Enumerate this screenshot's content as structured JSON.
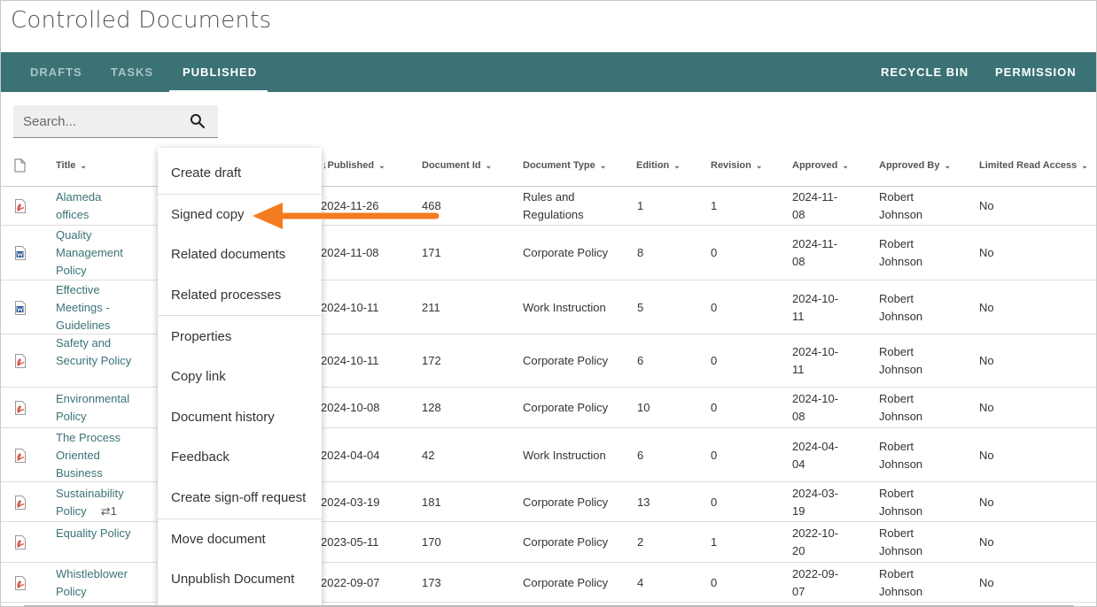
{
  "page_title": "Controlled Documents",
  "tabs": [
    {
      "label": "DRAFTS"
    },
    {
      "label": "TASKS"
    },
    {
      "label": "PUBLISHED"
    }
  ],
  "right_tabs": [
    {
      "label": "RECYCLE BIN"
    },
    {
      "label": "PERMISSION"
    }
  ],
  "active_tab": "PUBLISHED",
  "search": {
    "placeholder": "Search..."
  },
  "columns": [
    "Title",
    "Published",
    "Document Id",
    "Document Type",
    "Edition",
    "Revision",
    "Approved",
    "Approved By",
    "Limited Read Access"
  ],
  "sort": {
    "column": "Published",
    "direction": "descending"
  },
  "rows": [
    {
      "file": "pdf",
      "title": "Alameda offices",
      "published": "2024-11-26",
      "id": "468",
      "type": "Rules and Regulations",
      "edition": "1",
      "revision": "1",
      "approved": "2024-11-08",
      "approved_by": "Robert Johnson",
      "limited": "No"
    },
    {
      "file": "word",
      "title": "Quality Management Policy",
      "published": "2024-11-08",
      "id": "171",
      "type": "Corporate Policy",
      "edition": "8",
      "revision": "0",
      "approved": "2024-11-08",
      "approved_by": "Robert Johnson",
      "limited": "No"
    },
    {
      "file": "word",
      "title": "Effective Meetings - Guidelines",
      "published": "2024-10-11",
      "id": "211",
      "type": "Work Instruction",
      "edition": "5",
      "revision": "0",
      "approved": "2024-10-11",
      "approved_by": "Robert Johnson",
      "limited": "No"
    },
    {
      "file": "pdf",
      "title": "Safety and Security Policy",
      "published": "2024-10-11",
      "id": "172",
      "type": "Corporate Policy",
      "edition": "6",
      "revision": "0",
      "approved": "2024-10-11",
      "approved_by": "Robert Johnson",
      "limited": "No"
    },
    {
      "file": "pdf",
      "title": "Environmental Policy",
      "published": "2024-10-08",
      "id": "128",
      "type": "Corporate Policy",
      "edition": "10",
      "revision": "0",
      "approved": "2024-10-08",
      "approved_by": "Robert Johnson",
      "limited": "No"
    },
    {
      "file": "pdf",
      "title": "The Process Oriented Business",
      "published": "2024-04-04",
      "id": "42",
      "type": "Work Instruction",
      "edition": "6",
      "revision": "0",
      "approved": "2024-04-04",
      "approved_by": "Robert Johnson",
      "limited": "No"
    },
    {
      "file": "pdf",
      "title": "Sustainability Policy",
      "link_count": "1",
      "published": "2024-03-19",
      "id": "181",
      "type": "Corporate Policy",
      "edition": "13",
      "revision": "0",
      "approved": "2024-03-19",
      "approved_by": "Robert Johnson",
      "limited": "No"
    },
    {
      "file": "pdf",
      "title": "Equality Policy",
      "published": "2023-05-11",
      "id": "170",
      "type": "Corporate Policy",
      "edition": "2",
      "revision": "1",
      "approved": "2022-10-20",
      "approved_by": "Robert Johnson",
      "limited": "No"
    },
    {
      "file": "pdf",
      "title": "Whistleblower Policy",
      "published": "2022-09-07",
      "id": "173",
      "type": "Corporate Policy",
      "edition": "4",
      "revision": "0",
      "approved": "2022-09-07",
      "approved_by": "Robert Johnson",
      "limited": "No"
    }
  ],
  "context_menu": {
    "groups": [
      [
        "Create draft"
      ],
      [
        "Signed copy",
        "Related documents",
        "Related processes"
      ],
      [
        "Properties",
        "Copy link",
        "Document history",
        "Feedback",
        "Create sign-off request"
      ],
      [
        "Move document",
        "Unpublish Document"
      ]
    ],
    "highlighted": "Signed copy"
  },
  "colors": {
    "header_bar": "#3b7276",
    "title_link": "#3b7276",
    "arrow": "#f47c20",
    "pdf_icon": "#d9442e",
    "word_icon": "#2b5797"
  }
}
